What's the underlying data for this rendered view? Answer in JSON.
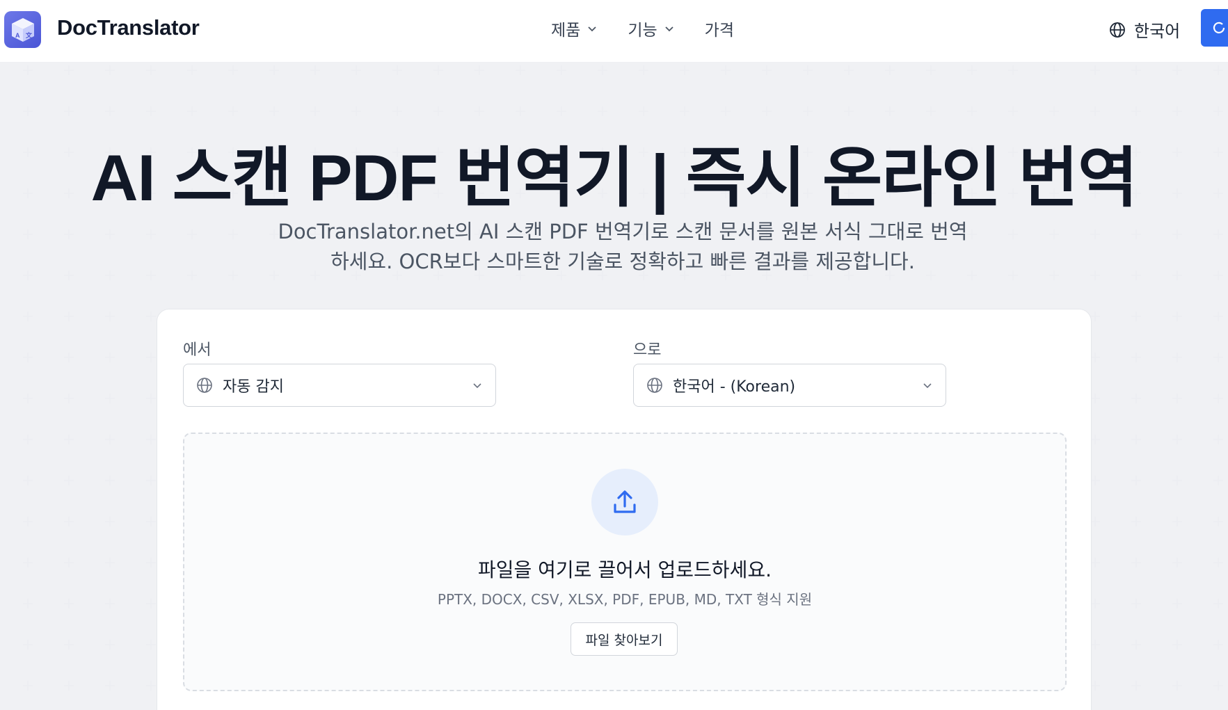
{
  "header": {
    "brand": "DocTranslator",
    "nav": [
      {
        "label": "제품",
        "has_dropdown": true
      },
      {
        "label": "기능",
        "has_dropdown": true
      },
      {
        "label": "가격",
        "has_dropdown": false
      }
    ],
    "language": "한국어",
    "accent_color": "#2f6bf0"
  },
  "hero": {
    "title": "AI 스캔 PDF 번역기 | 즉시 온라인 번역",
    "subtitle_line1": "DocTranslator.net의 AI 스캔 PDF 번역기로 스캔 문서를 원본 서식 그대로 번역",
    "subtitle_line2": "하세요. OCR보다 스마트한 기술로 정확하고 빠른 결과를 제공합니다."
  },
  "translator": {
    "from_label": "에서",
    "from_value": "자동 감지",
    "to_label": "으로",
    "to_value": "한국어 - (Korean)",
    "dropzone": {
      "title": "파일을 여기로 끌어서 업로드하세요.",
      "formats": "PPTX, DOCX, CSV, XLSX, PDF, EPUB, MD, TXT 형식 지원",
      "browse_label": "파일 찾아보기"
    }
  },
  "icons": {
    "logo": "cube-translate-logo",
    "globe": "globe-icon",
    "chevron": "chevron-down-icon",
    "upload": "upload-icon"
  }
}
